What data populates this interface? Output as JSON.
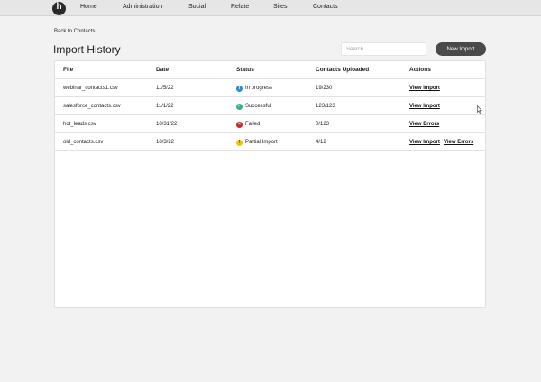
{
  "nav": {
    "logo": "h",
    "items": [
      "Home",
      "Administration",
      "Social",
      "Relate",
      "Sites",
      "Contacts"
    ]
  },
  "back_link": "Back to Contacts",
  "page_title": "Import History",
  "search": {
    "placeholder": "Search",
    "value": ""
  },
  "new_import_label": "New Import",
  "table": {
    "headers": [
      "File",
      "Date",
      "Status",
      "Contacts Uploaded",
      "Actions"
    ],
    "rows": [
      {
        "file": "webinar_contacts1.csv",
        "date": "11/5/22",
        "status": "In progress",
        "status_icon": "info-icon",
        "status_color": "#2b8fd6",
        "uploaded": "19/230",
        "actions": [
          "View Import"
        ]
      },
      {
        "file": "salesforce_contacts.csv",
        "date": "11/1/22",
        "status": "Successful",
        "status_icon": "check-icon",
        "status_color": "#2fb38a",
        "uploaded": "123/123",
        "actions": [
          "View Import"
        ]
      },
      {
        "file": "hot_leads.csv",
        "date": "10/31/22",
        "status": "Failed",
        "status_icon": "error-icon",
        "status_color": "#c62828",
        "uploaded": "0/123",
        "actions": [
          "View Errors"
        ]
      },
      {
        "file": "old_contacts.csv",
        "date": "10/3/22",
        "status": "Partial Import",
        "status_icon": "warning-icon",
        "status_color": "#f2c200",
        "uploaded": "4/12",
        "actions": [
          "View Import",
          "View Errors"
        ]
      }
    ]
  },
  "colors": {
    "background": "#f2f2f2",
    "button": "#4a4a4a",
    "nav": "#e6e6e6"
  }
}
